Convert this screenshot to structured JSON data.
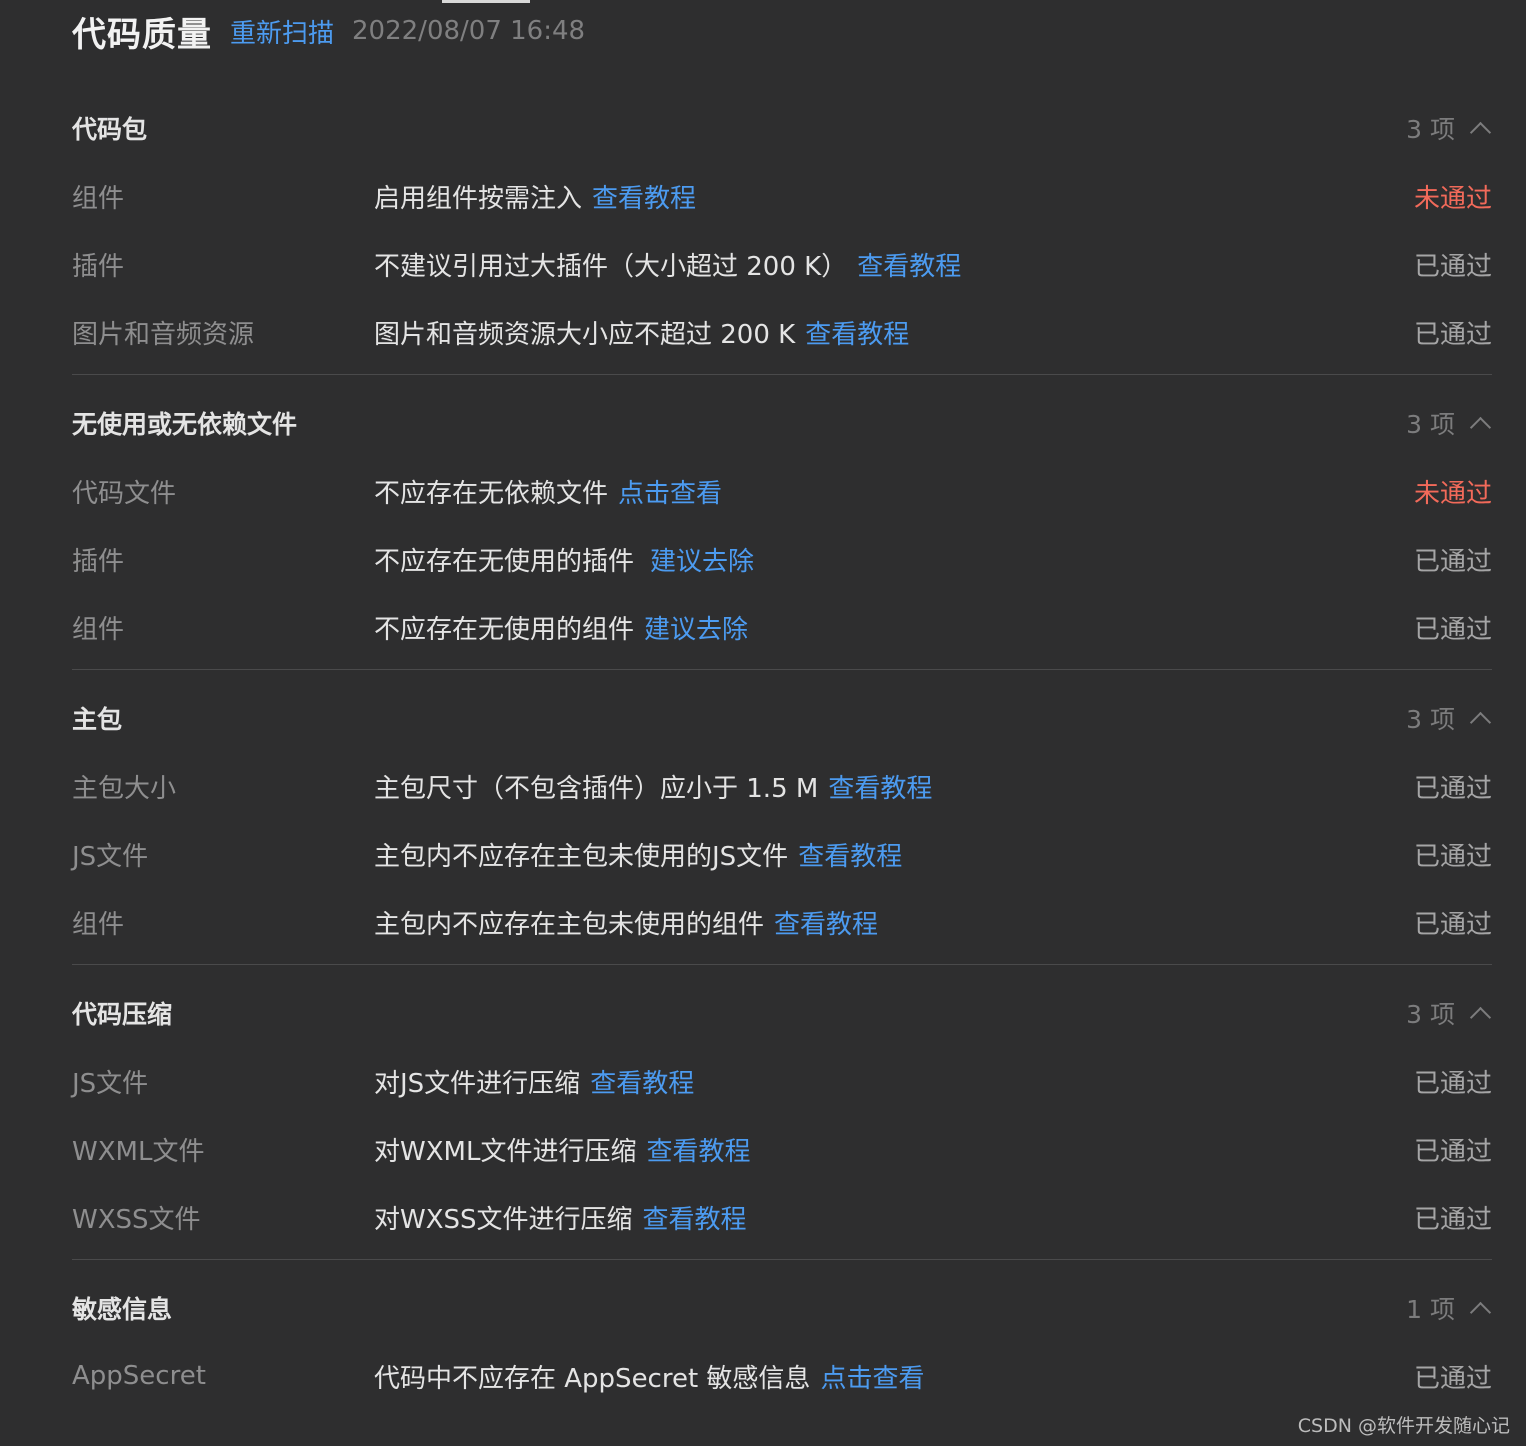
{
  "header": {
    "title": "代码质量",
    "rescan_label": "重新扫描",
    "scan_time": "2022/08/07 16:48"
  },
  "colors": {
    "background": "#2e2e2f",
    "link": "#4c9bf0",
    "fail": "#f26a5a",
    "pass": "#a5a5a6"
  },
  "sections": [
    {
      "title": "代码包",
      "count": "3 项",
      "rows": [
        {
          "name": "组件",
          "desc": "启用组件按需注入",
          "link": "查看教程",
          "status": "未通过",
          "failed": true
        },
        {
          "name": "插件",
          "desc": "不建议引用过大插件（大小超过 200 K）",
          "link": "查看教程",
          "status": "已通过",
          "failed": false
        },
        {
          "name": "图片和音频资源",
          "desc": "图片和音频资源大小应不超过 200 K",
          "link": "查看教程",
          "status": "已通过",
          "failed": false
        }
      ]
    },
    {
      "title": "无使用或无依赖文件",
      "count": "3 项",
      "rows": [
        {
          "name": "代码文件",
          "desc": "不应存在无依赖文件",
          "link": "点击查看",
          "status": "未通过",
          "failed": true
        },
        {
          "name": "插件",
          "desc": "不应存在无使用的插件",
          "link": "建议去除",
          "status": "已通过",
          "failed": false
        },
        {
          "name": "组件",
          "desc": "不应存在无使用的组件",
          "link": "建议去除",
          "status": "已通过",
          "failed": false
        }
      ]
    },
    {
      "title": "主包",
      "count": "3 项",
      "rows": [
        {
          "name": "主包大小",
          "desc": "主包尺寸（不包含插件）应小于 1.5 M",
          "link": "查看教程",
          "status": "已通过",
          "failed": false
        },
        {
          "name": "JS文件",
          "desc": "主包内不应存在主包未使用的JS文件",
          "link": "查看教程",
          "status": "已通过",
          "failed": false
        },
        {
          "name": "组件",
          "desc": "主包内不应存在主包未使用的组件",
          "link": "查看教程",
          "status": "已通过",
          "failed": false
        }
      ]
    },
    {
      "title": "代码压缩",
      "count": "3 项",
      "rows": [
        {
          "name": "JS文件",
          "desc": "对JS文件进行压缩",
          "link": "查看教程",
          "status": "已通过",
          "failed": false
        },
        {
          "name": "WXML文件",
          "desc": "对WXML文件进行压缩",
          "link": "查看教程",
          "status": "已通过",
          "failed": false
        },
        {
          "name": "WXSS文件",
          "desc": "对WXSS文件进行压缩",
          "link": "查看教程",
          "status": "已通过",
          "failed": false
        }
      ]
    },
    {
      "title": "敏感信息",
      "count": "1 项",
      "rows": [
        {
          "name": "AppSecret",
          "desc": "代码中不应存在 AppSecret 敏感信息",
          "link": "点击查看",
          "status": "已通过",
          "failed": false
        }
      ]
    }
  ],
  "watermark": "CSDN @软件开发随心记"
}
